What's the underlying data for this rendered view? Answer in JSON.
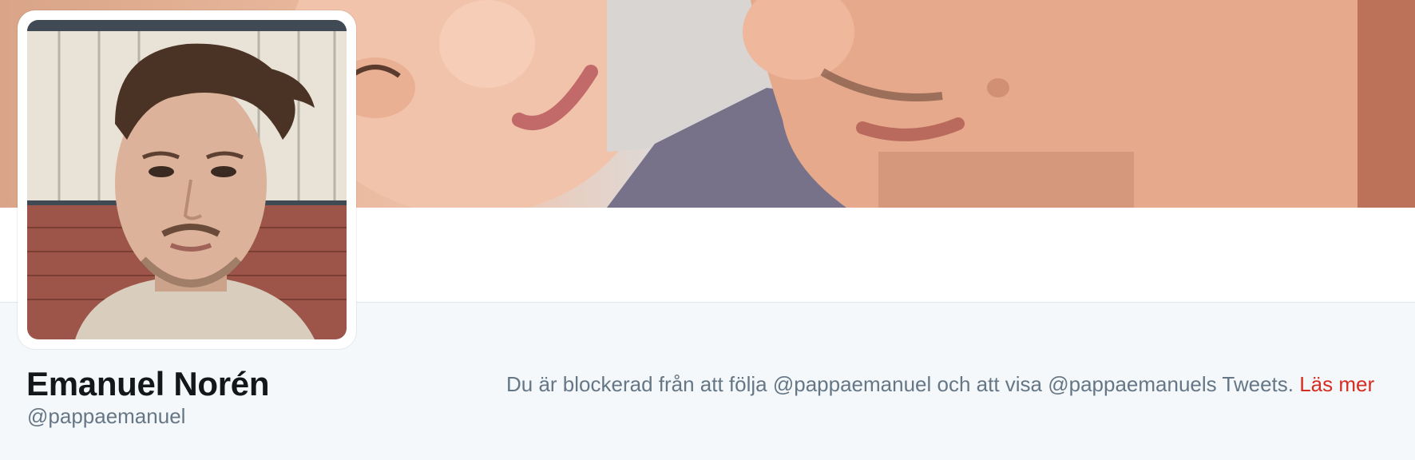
{
  "profile": {
    "name": "Emanuel Norén",
    "handle": "@pappaemanuel"
  },
  "notice": {
    "text": "Du är blockerad från att följa @pappaemanuel och att visa @pappaemanuels Tweets. ",
    "link_label": "Läs mer"
  },
  "colors": {
    "background": "#f5f8fa",
    "name_text": "#14171a",
    "secondary_text": "#657786",
    "link": "#d62d20"
  }
}
